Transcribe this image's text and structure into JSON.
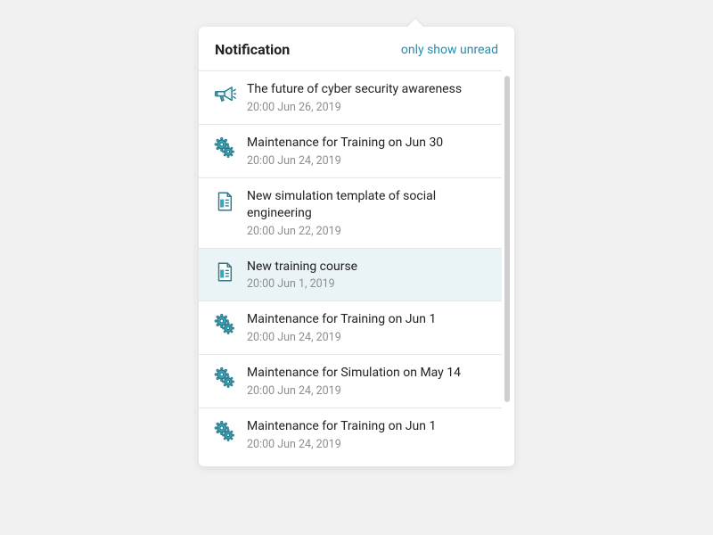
{
  "header": {
    "title": "Notification",
    "filter_link": "only show unread"
  },
  "icons": {
    "megaphone": "megaphone-icon",
    "gear": "gear-icon",
    "document": "document-icon"
  },
  "items": [
    {
      "icon": "megaphone",
      "title": "The future of cyber security awareness",
      "time": "20:00  Jun 26, 2019",
      "selected": false
    },
    {
      "icon": "gear",
      "title": "Maintenance for Training on Jun 30",
      "time": "20:00  Jun 24, 2019",
      "selected": false
    },
    {
      "icon": "document",
      "title": "New simulation template of social engineering",
      "time": "20:00  Jun 22, 2019",
      "selected": false
    },
    {
      "icon": "document",
      "title": "New training course",
      "time": "20:00  Jun 1, 2019",
      "selected": true
    },
    {
      "icon": "gear",
      "title": "Maintenance for Training on Jun 1",
      "time": "20:00  Jun 24, 2019",
      "selected": false
    },
    {
      "icon": "gear",
      "title": "Maintenance for Simulation on May 14",
      "time": "20:00  Jun 24, 2019",
      "selected": false
    },
    {
      "icon": "gear",
      "title": "Maintenance for Training on Jun 1",
      "time": "20:00  Jun 24, 2019",
      "selected": false
    }
  ]
}
